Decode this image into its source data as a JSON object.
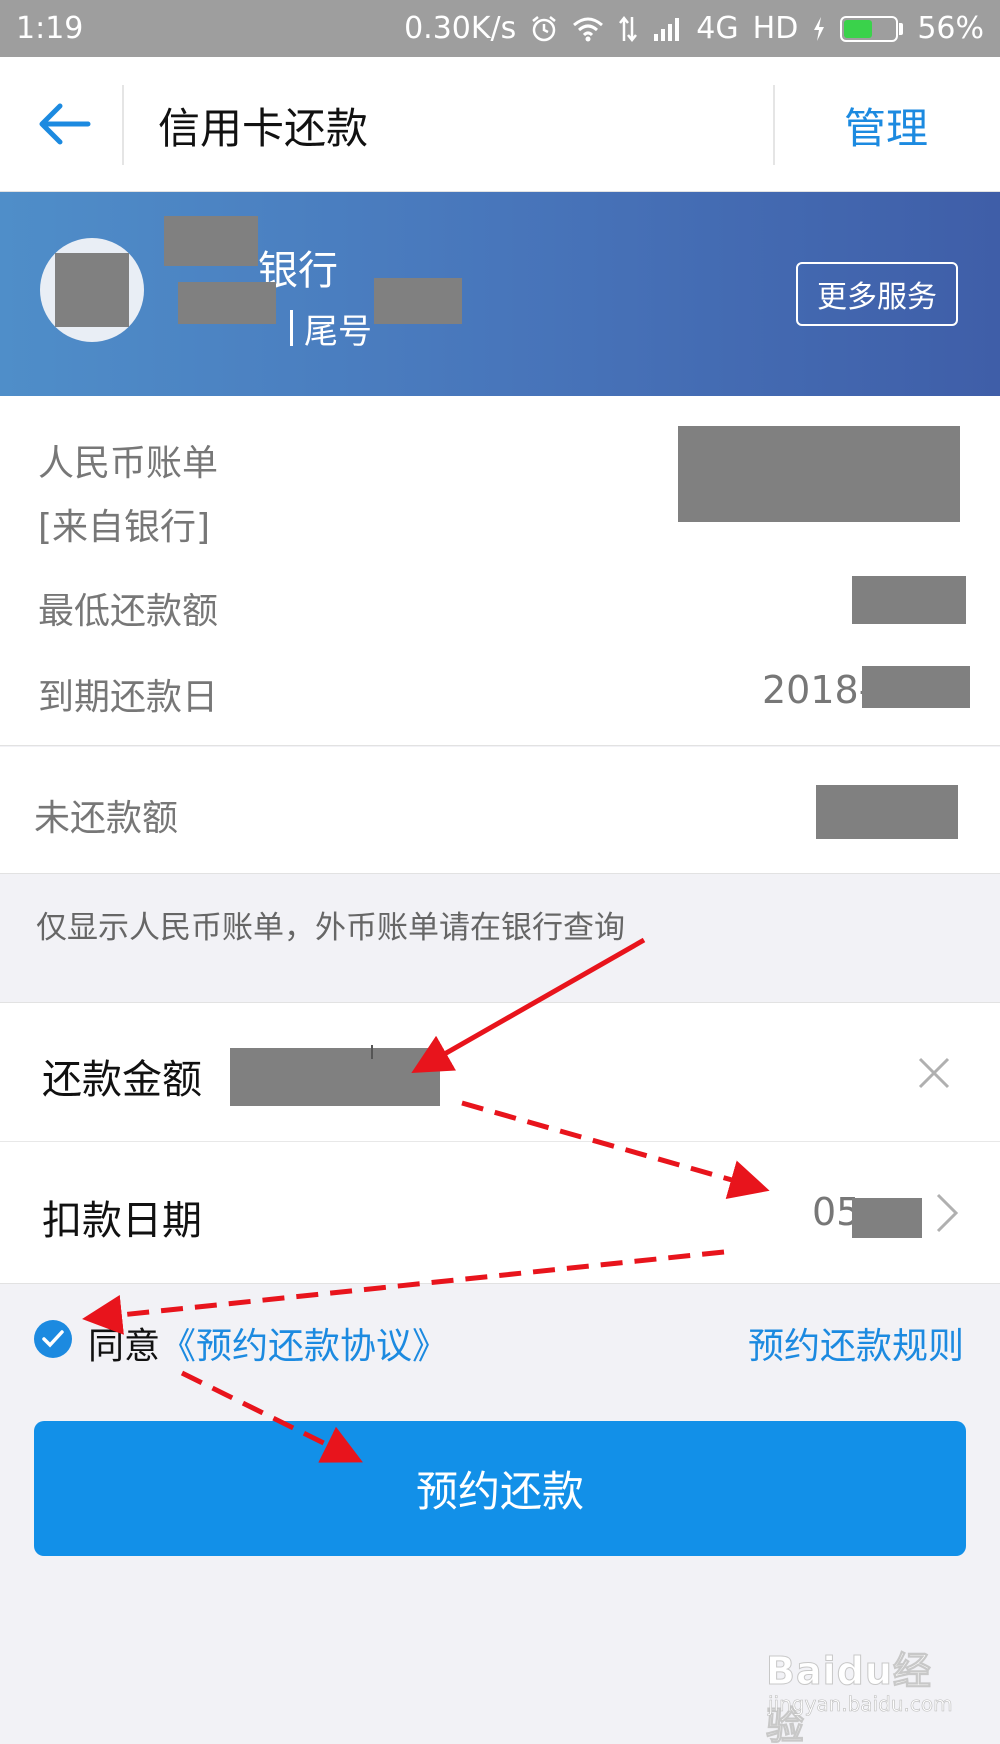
{
  "status_bar": {
    "time": "1:19",
    "network_speed": "0.30K/s",
    "network_type": "4G",
    "hd_label": "HD",
    "battery": "56%",
    "battery_level": 0.56,
    "icons": [
      "alarm-icon",
      "wifi-icon",
      "data-arrows-icon",
      "signal-icon",
      "charging-icon",
      "battery-icon"
    ]
  },
  "nav": {
    "title": "信用卡还款",
    "manage_label": "管理",
    "back_icon": "back-arrow-icon"
  },
  "bank": {
    "name_suffix": "银行",
    "tail_label": "尾号",
    "more_services_label": "更多服务"
  },
  "bill": {
    "rmb_bill_label": "人民币账单",
    "source_label": "[来自银行]",
    "min_payment_label": "最低还款额",
    "due_date_label": "到期还款日",
    "due_date_prefix": "2018-",
    "unpaid_label": "未还款额"
  },
  "note": "仅显示人民币账单，外币账单请在银行查询",
  "form": {
    "amount_label": "还款金额",
    "date_label": "扣款日期",
    "date_prefix": "05",
    "clear_icon": "close-icon",
    "chevron_icon": "chevron-right-icon"
  },
  "agreement": {
    "agree_label": "同意",
    "agreement_link": "《预约还款协议》",
    "rules_link": "预约还款规则",
    "checked": true
  },
  "submit_label": "预约还款",
  "colors": {
    "accent": "#1c8ae0",
    "button": "#1290e8",
    "header_gradient_start": "#4f8ec9",
    "header_gradient_end": "#3f5ea8",
    "annotation_red": "#e8141c"
  },
  "watermark": {
    "brand": "Baidu经验",
    "url": "jingyan.baidu.com"
  }
}
